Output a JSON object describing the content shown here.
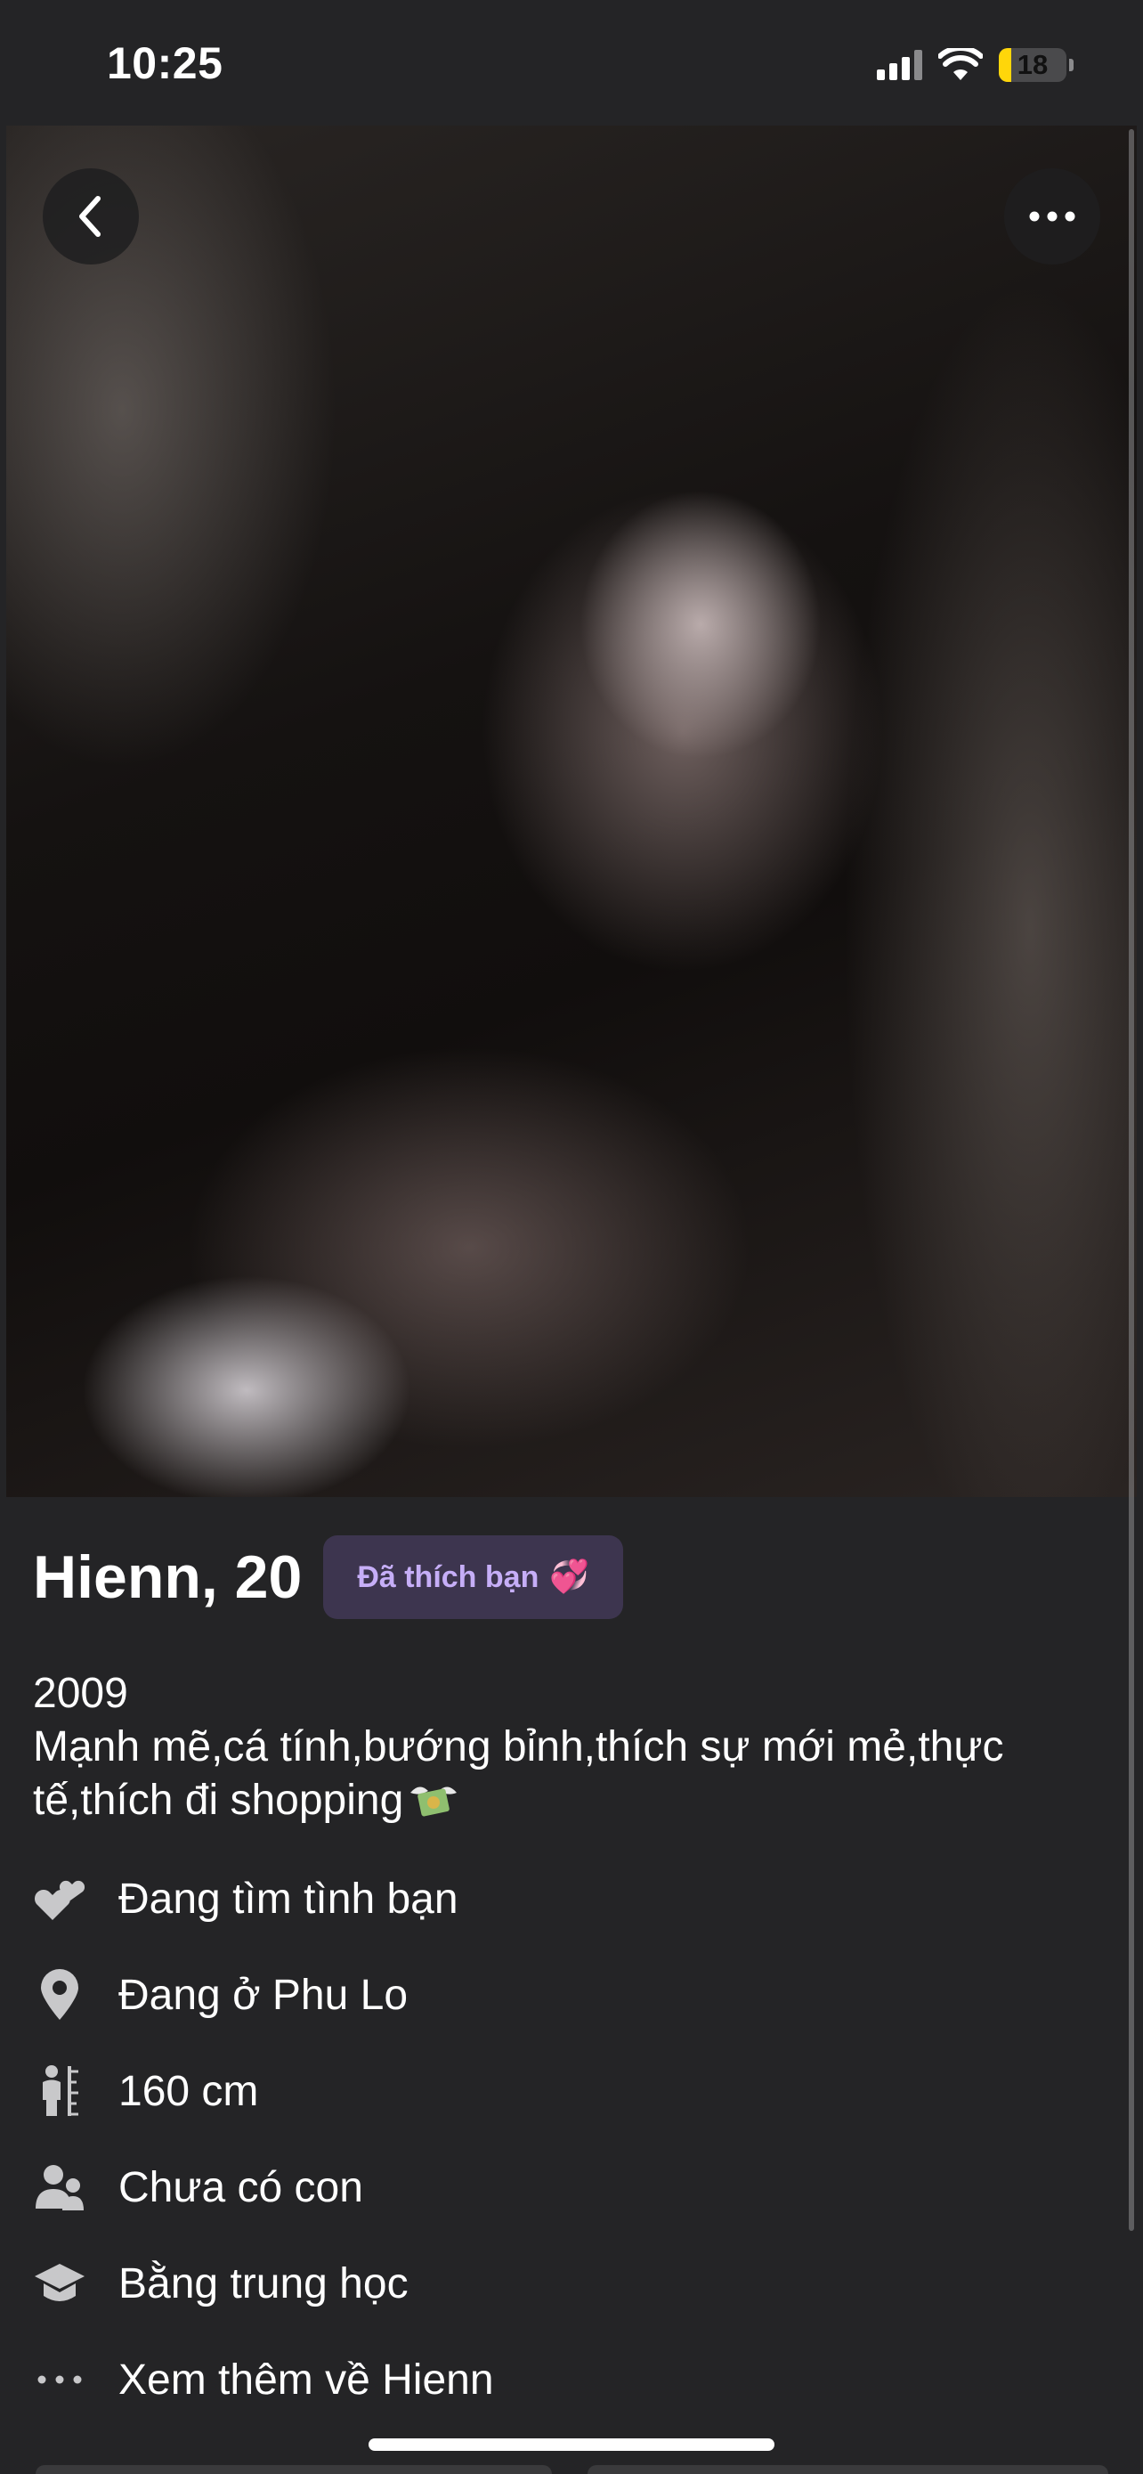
{
  "status_bar": {
    "time": "10:25",
    "battery_level": "18",
    "battery_fraction": 0.18,
    "icons": [
      "signal-icon",
      "wifi-icon",
      "battery-icon"
    ]
  },
  "photo": {
    "back_icon": "chevron-left-icon",
    "more_icon": "ellipsis-icon"
  },
  "profile": {
    "name_age": "Hienn, 20",
    "liked_badge": "Đã thích bạn",
    "liked_badge_emoji": "💞",
    "bio_line1": "2009",
    "bio_line2": "Mạnh mẽ,cá tính,bướng bỉnh,thích sự mới mẻ,thực",
    "bio_line3": "tế,thích đi shopping",
    "bio_emoji": "money-with-wings"
  },
  "details": [
    {
      "icon": "hearts-icon",
      "label": "Đang tìm tình bạn"
    },
    {
      "icon": "location-pin-icon",
      "label": "Đang ở Phu Lo"
    },
    {
      "icon": "height-icon",
      "label": "160 cm"
    },
    {
      "icon": "people-icon",
      "label": "Chưa có con"
    },
    {
      "icon": "graduation-cap-icon",
      "label": "Bằng trung học"
    },
    {
      "icon": "more-dots-icon",
      "label": "Xem thêm về Hienn"
    }
  ],
  "colors": {
    "background": "#242426",
    "badge_bg": "#3d354f",
    "badge_text": "#c6aef7",
    "battery": "#ffd60a",
    "icon": "#c8c8ca"
  }
}
